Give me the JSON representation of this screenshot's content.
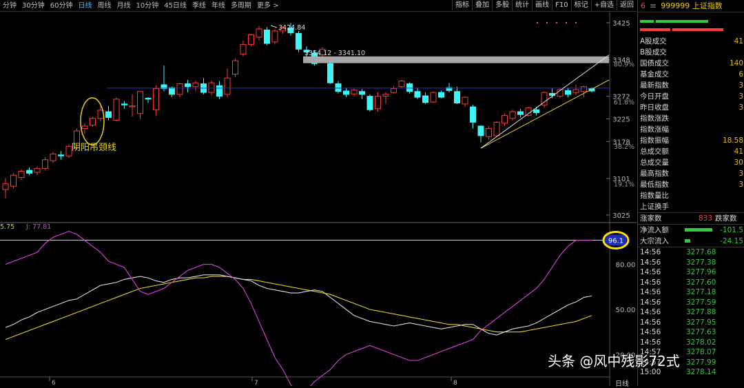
{
  "toolbar": {
    "tabs": [
      "分钟",
      "30分钟",
      "60分钟",
      "日线",
      "周线",
      "月线",
      "10分钟",
      "45日线",
      "季线",
      "年线",
      "多周期",
      "更多 >"
    ],
    "tools": [
      "指标",
      "叠加",
      "多股",
      "统计",
      "画线",
      "F10",
      "标记",
      "+自选",
      "返回"
    ]
  },
  "main_chart": {
    "y_ticks": [
      "3425",
      "3348",
      "3272",
      "3225",
      "3178",
      "3101",
      "3025"
    ],
    "pct_ticks": [
      "80.9%",
      "61.8%",
      "38.2%",
      "19.1%"
    ],
    "high_label": "3424.84",
    "range_label": "3354.12 - 3341.10",
    "annotation": "阴阳吊颈线",
    "x_labels": [
      "6",
      "7",
      "8"
    ]
  },
  "indicator": {
    "label_left": "5.75",
    "label_j": "J: 77.81",
    "marker_value": "96.1",
    "y_ticks": [
      "80.00",
      "50.00",
      "20.00"
    ]
  },
  "panel": {
    "code": "6",
    "title": "999999 上证指数",
    "stats": [
      {
        "label": "A股成交",
        "value": "41"
      },
      {
        "label": "B股成交",
        "value": ""
      },
      {
        "label": "国债成交",
        "value": "140"
      },
      {
        "label": "基金成交",
        "value": "6"
      },
      {
        "label": "最新指数",
        "value": "3"
      },
      {
        "label": "今日开盘",
        "value": "3"
      },
      {
        "label": "昨日收盘",
        "value": "3"
      },
      {
        "label": "指数涨跌",
        "value": ""
      },
      {
        "label": "指数涨幅",
        "value": ""
      },
      {
        "label": "指数振幅",
        "value": "18.58"
      },
      {
        "label": "总成交额",
        "value": "41"
      },
      {
        "label": "总成交量",
        "value": "30"
      },
      {
        "label": "最高指数",
        "value": "3"
      },
      {
        "label": "最低指数",
        "value": "3"
      },
      {
        "label": "指数量比",
        "value": ""
      },
      {
        "label": "上证换手",
        "value": ""
      }
    ],
    "breadth": {
      "up_label": "涨家数",
      "up_value": "833",
      "down_label": "跌家数"
    },
    "flows": [
      {
        "label": "净流入额",
        "value": "-101.5"
      },
      {
        "label": "大宗流入",
        "value": "-24.15"
      }
    ],
    "ticks": [
      {
        "time": "14:56",
        "price": "3277.68"
      },
      {
        "time": "14:56",
        "price": "3277.38"
      },
      {
        "time": "14:56",
        "price": "3277.96"
      },
      {
        "time": "14:56",
        "price": "3277.60"
      },
      {
        "time": "14:56",
        "price": "3277.18"
      },
      {
        "time": "14:56",
        "price": "3277.59"
      },
      {
        "time": "14:56",
        "price": "3277.88"
      },
      {
        "time": "14:56",
        "price": "3277.95"
      },
      {
        "time": "14:56",
        "price": "3277.63"
      },
      {
        "time": "14:56",
        "price": "3278.02"
      },
      {
        "time": "14:57",
        "price": "3278.07"
      },
      {
        "time": "14:57",
        "price": "3277.99"
      },
      {
        "time": "15:00",
        "price": "3278.14"
      }
    ],
    "day_button": "日线"
  },
  "watermark": "头条 @风中残影72式",
  "colors": {
    "up": "#ff3b3b",
    "down": "#3ff6f6",
    "purple": "#e040e0",
    "yellow": "#e6d21e",
    "white": "#dcdcdc"
  },
  "candles": [
    [
      3078,
      3090,
      3060,
      3102
    ],
    [
      3085,
      3108,
      3080,
      3112
    ],
    [
      3103,
      3116,
      3098,
      3120
    ],
    [
      3118,
      3112,
      3108,
      3124
    ],
    [
      3114,
      3122,
      3108,
      3126
    ],
    [
      3122,
      3140,
      3118,
      3145
    ],
    [
      3138,
      3152,
      3133,
      3156
    ],
    [
      3150,
      3148,
      3140,
      3158
    ],
    [
      3148,
      3168,
      3144,
      3172
    ],
    [
      3165,
      3200,
      3160,
      3205
    ],
    [
      3205,
      3210,
      3194,
      3216
    ],
    [
      3212,
      3226,
      3208,
      3230
    ],
    [
      3226,
      3243,
      3220,
      3256
    ],
    [
      3240,
      3228,
      3222,
      3252
    ],
    [
      3222,
      3266,
      3220,
      3270
    ],
    [
      3256,
      3254,
      3246,
      3262
    ],
    [
      3250,
      3252,
      3230,
      3276
    ],
    [
      3236,
      3282,
      3224,
      3282
    ],
    [
      3268,
      3266,
      3258,
      3270
    ],
    [
      3244,
      3288,
      3232,
      3295
    ],
    [
      3296,
      3288,
      3282,
      3336
    ],
    [
      3290,
      3276,
      3270,
      3292
    ],
    [
      3276,
      3298,
      3270,
      3300
    ],
    [
      3298,
      3292,
      3280,
      3306
    ],
    [
      3292,
      3300,
      3282,
      3305
    ],
    [
      3298,
      3280,
      3276,
      3310
    ],
    [
      3280,
      3300,
      3274,
      3305
    ],
    [
      3294,
      3272,
      3266,
      3304
    ],
    [
      3276,
      3310,
      3270,
      3330
    ],
    [
      3318,
      3346,
      3312,
      3350
    ],
    [
      3360,
      3380,
      3355,
      3388
    ],
    [
      3380,
      3400,
      3376,
      3402
    ],
    [
      3395,
      3412,
      3388,
      3418
    ],
    [
      3410,
      3382,
      3378,
      3416
    ],
    [
      3385,
      3408,
      3380,
      3412
    ],
    [
      3408,
      3414,
      3402,
      3418
    ],
    [
      3414,
      3404,
      3398,
      3425
    ],
    [
      3403,
      3370,
      3364,
      3408
    ],
    [
      3368,
      3364,
      3352,
      3376
    ],
    [
      3362,
      3340,
      3336,
      3368
    ],
    [
      3358,
      3370,
      3352,
      3374
    ],
    [
      3340,
      3300,
      3298,
      3344
    ],
    [
      3298,
      3282,
      3278,
      3304
    ],
    [
      3283,
      3276,
      3270,
      3290
    ],
    [
      3277,
      3285,
      3272,
      3288
    ],
    [
      3282,
      3276,
      3266,
      3287
    ],
    [
      3272,
      3244,
      3240,
      3276
    ],
    [
      3246,
      3272,
      3240,
      3280
    ],
    [
      3272,
      3276,
      3256,
      3280
    ],
    [
      3280,
      3288,
      3278,
      3293
    ],
    [
      3292,
      3304,
      3290,
      3306
    ],
    [
      3298,
      3282,
      3278,
      3301
    ],
    [
      3282,
      3270,
      3266,
      3290
    ],
    [
      3273,
      3259,
      3256,
      3280
    ],
    [
      3260,
      3280,
      3258,
      3282
    ],
    [
      3280,
      3270,
      3268,
      3284
    ],
    [
      3290,
      3284,
      3280,
      3300
    ],
    [
      3282,
      3258,
      3256,
      3292
    ],
    [
      3256,
      3270,
      3250,
      3272
    ],
    [
      3250,
      3218,
      3205,
      3254
    ],
    [
      3210,
      3190,
      3176,
      3212
    ],
    [
      3188,
      3205,
      3182,
      3210
    ],
    [
      3190,
      3218,
      3188,
      3220
    ],
    [
      3216,
      3232,
      3210,
      3236
    ],
    [
      3226,
      3240,
      3222,
      3244
    ],
    [
      3240,
      3234,
      3228,
      3246
    ],
    [
      3232,
      3248,
      3230,
      3250
    ],
    [
      3244,
      3238,
      3232,
      3250
    ],
    [
      3254,
      3280,
      3248,
      3282
    ],
    [
      3278,
      3274,
      3268,
      3288
    ],
    [
      3272,
      3286,
      3268,
      3288
    ],
    [
      3284,
      3276,
      3270,
      3290
    ],
    [
      3280,
      3286,
      3274,
      3296
    ],
    [
      3282,
      3292,
      3270,
      3294
    ],
    [
      3288,
      3283,
      3280,
      3291
    ]
  ],
  "kdj": {
    "k": [
      38,
      40,
      43,
      45,
      48,
      50,
      52,
      54,
      56,
      57,
      60,
      63,
      66,
      67,
      68,
      70,
      71,
      72,
      71,
      69,
      68,
      70,
      71,
      71,
      72,
      73,
      73,
      73,
      72,
      71,
      70,
      69,
      66,
      64,
      63,
      62,
      61,
      61,
      62,
      63,
      62,
      58,
      54,
      50,
      46,
      44,
      42,
      41,
      40,
      39,
      40,
      41,
      40,
      39,
      38,
      37,
      38,
      39,
      40,
      40,
      37,
      34,
      33,
      35,
      37,
      38,
      39,
      41,
      44,
      47,
      50,
      53,
      55,
      58,
      59
    ],
    "d": [
      30,
      32,
      34,
      36,
      38,
      40,
      42,
      44,
      46,
      48,
      50,
      52,
      54,
      56,
      58,
      60,
      62,
      64,
      65,
      66,
      67,
      68,
      69,
      70,
      71,
      71,
      72,
      72,
      72,
      71,
      70,
      70,
      69,
      68,
      67,
      66,
      65,
      64,
      63,
      62,
      61,
      60,
      58,
      56,
      54,
      52,
      50,
      49,
      48,
      47,
      46,
      45,
      44,
      43,
      42,
      41,
      40,
      40,
      39,
      38,
      37,
      36,
      35,
      35,
      35,
      35,
      36,
      37,
      38,
      39,
      40,
      41,
      42,
      44,
      46
    ],
    "j": [
      80,
      82,
      84,
      86,
      88,
      94,
      98,
      100,
      102,
      100,
      96,
      92,
      88,
      82,
      80,
      78,
      70,
      62,
      60,
      62,
      64,
      68,
      72,
      76,
      78,
      80,
      80,
      78,
      74,
      70,
      64,
      54,
      42,
      30,
      18,
      10,
      0,
      -8,
      -4,
      2,
      6,
      10,
      16,
      20,
      22,
      24,
      26,
      24,
      22,
      20,
      18,
      16,
      16,
      18,
      20,
      22,
      24,
      26,
      28,
      30,
      36,
      40,
      44,
      48,
      52,
      56,
      60,
      64,
      70,
      78,
      86,
      92,
      96,
      96,
      96
    ]
  }
}
